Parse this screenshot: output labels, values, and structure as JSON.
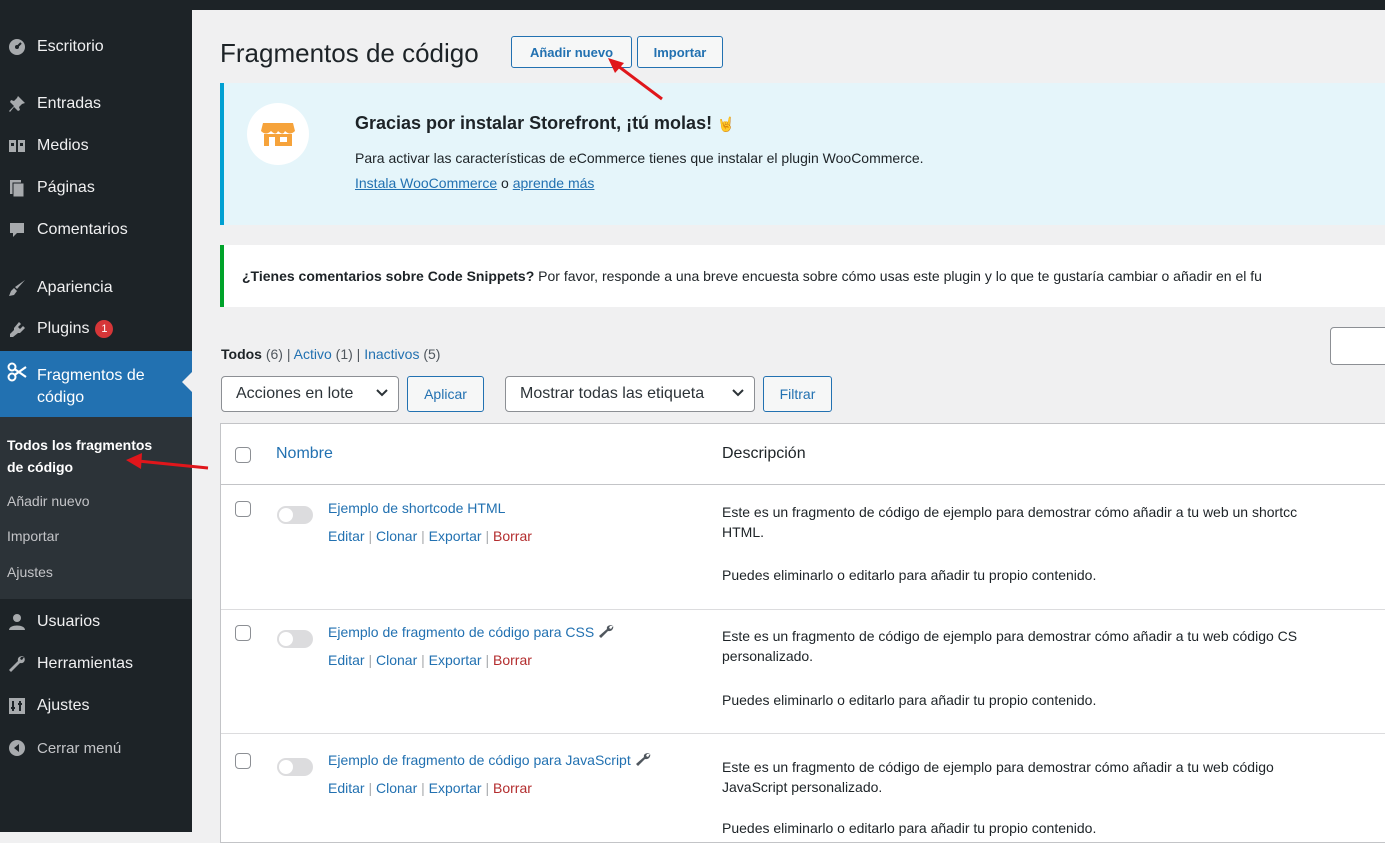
{
  "sidebar": {
    "items": [
      {
        "label": "Escritorio",
        "icon": "dashboard-icon"
      },
      {
        "label": "Entradas",
        "icon": "pin-icon"
      },
      {
        "label": "Medios",
        "icon": "media-icon"
      },
      {
        "label": "Páginas",
        "icon": "pages-icon"
      },
      {
        "label": "Comentarios",
        "icon": "comments-icon"
      },
      {
        "label": "Apariencia",
        "icon": "brush-icon"
      },
      {
        "label": "Plugins",
        "icon": "plugins-icon",
        "badge": "1"
      },
      {
        "label": "Fragmentos de",
        "label2": "código",
        "icon": "scissors-icon"
      },
      {
        "label": "Usuarios",
        "icon": "users-icon"
      },
      {
        "label": "Herramientas",
        "icon": "wrench-icon"
      },
      {
        "label": "Ajustes",
        "icon": "settings-icon"
      },
      {
        "label": "Cerrar menú",
        "icon": "collapse-icon"
      }
    ],
    "submenu": {
      "current_line1": "Todos los fragmentos",
      "current_line2": "de código",
      "add_new": "Añadir nuevo",
      "import": "Importar",
      "settings": "Ajustes"
    }
  },
  "header": {
    "title": "Fragmentos de código",
    "add_new": "Añadir nuevo",
    "import": "Importar"
  },
  "storefront_notice": {
    "title": "Gracias por instalar Storefront, ¡tú molas!",
    "emoji": "🤘",
    "text": "Para activar las características de eCommerce tienes que instalar el plugin WooCommerce.",
    "link1": "Instala WooCommerce",
    "connector": "o",
    "link2": "aprende más"
  },
  "feedback_notice": {
    "bold": "¿Tienes comentarios sobre Code Snippets?",
    "text": "Por favor, responde a una breve encuesta sobre cómo usas este plugin y lo que te gustaría cambiar o añadir en el fu"
  },
  "filters": {
    "all_label": "Todos",
    "all_count": "(6)",
    "active_label": "Activo",
    "active_count": "(1)",
    "inactive_label": "Inactivos",
    "inactive_count": "(5)",
    "bulk_select": "Acciones en lote",
    "apply": "Aplicar",
    "tags_select": "Mostrar todas las etiqueta",
    "filter": "Filtrar"
  },
  "table": {
    "col_name": "Nombre",
    "col_desc": "Descripción",
    "action_edit": "Editar",
    "action_clone": "Clonar",
    "action_export": "Exportar",
    "action_delete": "Borrar",
    "rows": [
      {
        "title": "Ejemplo de shortcode HTML",
        "desc1": "Este es un fragmento de código de ejemplo para demostrar cómo añadir a tu web un shortcc",
        "desc2": "HTML.",
        "desc3": "Puedes eliminarlo o editarlo para añadir tu propio contenido."
      },
      {
        "title": "Ejemplo de fragmento de código para CSS",
        "desc1": "Este es un fragmento de código de ejemplo para demostrar cómo añadir a tu web código CS",
        "desc2": "personalizado.",
        "desc3": "Puedes eliminarlo o editarlo para añadir tu propio contenido."
      },
      {
        "title": "Ejemplo de fragmento de código para JavaScript",
        "desc1": "Este es un fragmento de código de ejemplo para demostrar cómo añadir a tu web código",
        "desc2": "JavaScript personalizado.",
        "desc3": "Puedes eliminarlo o editarlo para añadir tu propio contenido."
      }
    ]
  },
  "colors": {
    "sidebar_bg": "#1d2327",
    "accent": "#2271b1",
    "delete": "#b32d2e",
    "annotation_arrow": "#e0161b"
  }
}
